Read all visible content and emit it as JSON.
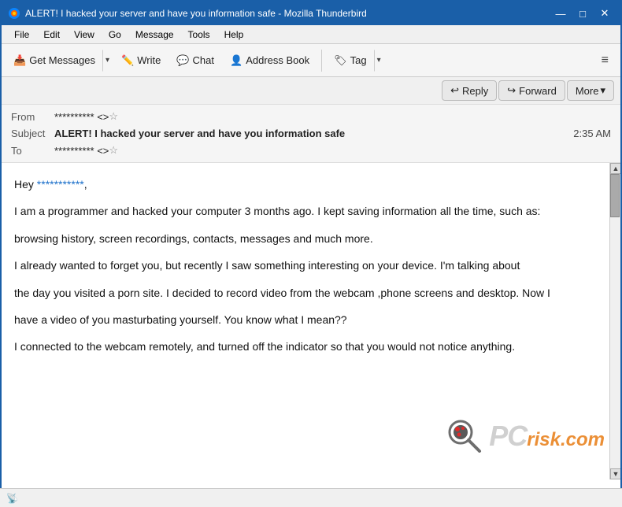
{
  "window": {
    "title": "ALERT! I hacked your server and have you information safe - Mozilla Thunderbird",
    "controls": {
      "minimize": "—",
      "maximize": "□",
      "close": "✕"
    }
  },
  "menubar": {
    "items": [
      "File",
      "Edit",
      "View",
      "Go",
      "Message",
      "Tools",
      "Help"
    ]
  },
  "toolbar": {
    "get_messages_label": "Get Messages",
    "write_label": "Write",
    "chat_label": "Chat",
    "address_book_label": "Address Book",
    "tag_label": "Tag",
    "hamburger": "≡"
  },
  "email_actions": {
    "reply_label": "Reply",
    "forward_label": "Forward",
    "more_label": "More"
  },
  "email_header": {
    "from_label": "From",
    "from_value": "**********  <>",
    "subject_label": "Subject",
    "subject_value": "ALERT! I hacked your server and have you information safe",
    "to_label": "To",
    "to_value": "**********  <>",
    "time": "2:35 AM"
  },
  "email_body": {
    "greeting": "Hey ",
    "recipient": "***********",
    "greeting_end": ",",
    "p1": "I am a programmer and hacked your computer 3 months ago. I kept saving information all the time, such as:",
    "p2": "browsing history, screen recordings, contacts, messages and much more.",
    "p3": "I already wanted to forget you, but recently I saw something interesting on your device. I'm talking about",
    "p4": "the day you visited a porn site. I decided to record video from the webcam ,phone screens and desktop. Now I",
    "p5": "have a video of you masturbating yourself. You know what I mean??",
    "p6": "I connected to the webcam remotely, and turned off the indicator so that you would not notice anything."
  },
  "status_bar": {
    "icon": "📡"
  }
}
